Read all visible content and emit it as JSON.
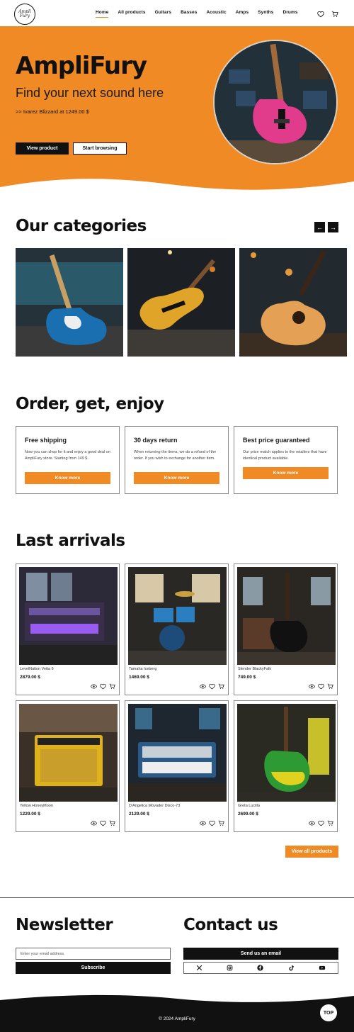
{
  "brand": {
    "logo_text": "AmpliFury"
  },
  "nav": {
    "links": [
      "Home",
      "All products",
      "Guitars",
      "Basses",
      "Acoustic",
      "Amps",
      "Synths",
      "Drums"
    ],
    "active": "Home"
  },
  "hero": {
    "title": "AmpliFury",
    "subtitle": "Find your next sound here",
    "promo": ">> Ivarez Blizzard at 1249.00 $",
    "primary_button": "View product",
    "secondary_button": "Start browsing"
  },
  "categories": {
    "title": "Our categories",
    "prev": "←",
    "next": "→"
  },
  "features": {
    "title": "Order, get, enjoy",
    "items": [
      {
        "title": "Free shipping",
        "text": "Now you can shop for it and enjoy a good deal on AmpliFury store. Starting from 149 $.",
        "button": "Know more"
      },
      {
        "title": "30 days return",
        "text": "When returning the items, we do a refund of the order. If you wish to exchange for another item.",
        "button": "Know more"
      },
      {
        "title": "Best price guaranteed",
        "text": "Our price match applies to the retailers that have identical product available.",
        "button": "Know more"
      }
    ]
  },
  "arrivals": {
    "title": "Last arrivals",
    "products": [
      {
        "name": "LevelNation Vetta 6",
        "price": "2879.00 $"
      },
      {
        "name": "Tamaha Iceberg",
        "price": "1469.00 $"
      },
      {
        "name": "Slender BlackyFalk",
        "price": "749.00 $"
      },
      {
        "name": "Yellow HoneyMoon",
        "price": "1229.00 $"
      },
      {
        "name": "D'Angelica Movader Disco-73",
        "price": "2129.00 $"
      },
      {
        "name": "Greta Lucilla",
        "price": "2699.00 $"
      }
    ],
    "view_all": "View all products"
  },
  "newsletter": {
    "title": "Newsletter",
    "placeholder": "Enter your email address",
    "button": "Subscribe"
  },
  "contact": {
    "title": "Contact us",
    "button": "Send us an email",
    "socials": [
      "X",
      "Instagram",
      "Facebook",
      "TikTok",
      "YouTube"
    ]
  },
  "footer": {
    "copyright": "© 2024 AmpliFury",
    "top_button": "TOP"
  },
  "colors": {
    "accent": "#f08a24",
    "dark": "#111111"
  }
}
